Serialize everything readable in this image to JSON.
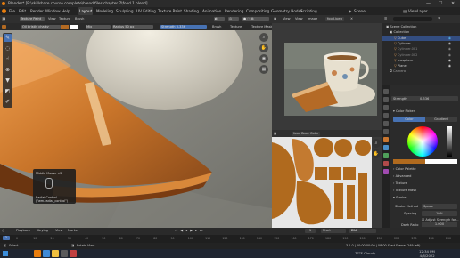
{
  "titlebar": {
    "title": "Blender* [E:\\skillshare course complete\\blend files chapter 7\\food 1.blend]",
    "minimize": "—",
    "maximize": "☐",
    "close": "✕"
  },
  "menu": [
    "File",
    "Edit",
    "Render",
    "Window",
    "Help"
  ],
  "workspaces": [
    "Layout",
    "Modeling",
    "Sculpting",
    "UV Editing",
    "Texture Paint",
    "Shading",
    "Animation",
    "Rendering",
    "Compositing",
    "Geometry Nodes",
    "Scripting"
  ],
  "active_workspace": "Layout",
  "scene": {
    "label": "Scene",
    "view_layer": "ViewLayer"
  },
  "tool_header": {
    "mode": "Texture Paint",
    "menus": [
      "View",
      "Texture",
      "Brush"
    ],
    "brush": "Oil bristly chalky",
    "blend": "Mix",
    "radius_label": "Radius",
    "radius": "50 px",
    "strength_label": "Strength",
    "strength": "0.336",
    "brush_menu": "Brush",
    "texture_menu": "Texture",
    "texture_mask": "Texture Mask"
  },
  "tools": [
    "brush-icon",
    "blur-icon",
    "smear-icon",
    "clone-icon",
    "fill-icon",
    "mask-icon",
    "annotate-icon"
  ],
  "nav_gizmo": [
    "zoom-icon",
    "hand-icon",
    "camera-icon",
    "grid-icon"
  ],
  "hud": {
    "line1": "Middle Mouse ×2",
    "line2": "Radial Control (“wm.radial_control”)"
  },
  "image_editor": {
    "menus": [
      "View",
      "View",
      "Image"
    ],
    "filename": "food.jpeg"
  },
  "uv_editor": {
    "header": "food Base Color"
  },
  "outliner": {
    "rows": [
      {
        "name": "Scene Collection",
        "indent": 0
      },
      {
        "name": "Collection",
        "indent": 1
      },
      {
        "name": "Cube",
        "indent": 2,
        "selected": true
      },
      {
        "name": "Cylinder",
        "indent": 2
      },
      {
        "name": "Cylinder.001",
        "indent": 2
      },
      {
        "name": "Cylinder.002",
        "indent": 2
      },
      {
        "name": "Icosphere",
        "indent": 2
      },
      {
        "name": "Plane",
        "indent": 2
      },
      {
        "name": "Camera",
        "indent": 1
      }
    ]
  },
  "properties": {
    "strength_label": "Strength",
    "strength": "0.336",
    "color_picker": "Color Picker",
    "tabs": [
      "Color",
      "Gradient"
    ],
    "active_tab": "Color",
    "sections": [
      "Color Palette",
      "Advanced",
      "Texture",
      "Texture Mask",
      "Stroke"
    ],
    "stroke_method_label": "Stroke Method",
    "stroke_method": "Space",
    "spacing_label": "Spacing",
    "spacing": "10%",
    "adjust_strength": "Adjust Strength for...",
    "dash_ratio_label": "Dash Ratio",
    "dash_ratio": "1.000",
    "dash_length_label": "Dash Length",
    "dash_length": "20",
    "wheel_value": "1"
  },
  "timeline": {
    "menus": [
      "Playback",
      "Keying",
      "View",
      "Marker"
    ],
    "ruler": [
      "0",
      "10",
      "20",
      "30",
      "40",
      "50",
      "60",
      "70",
      "80",
      "90",
      "100",
      "110",
      "120",
      "130",
      "140",
      "150",
      "160",
      "170",
      "180",
      "190",
      "200",
      "210",
      "220",
      "230",
      "240",
      "250"
    ],
    "current_frame": "1",
    "start_label": "Start",
    "start": "1",
    "end_label": "End",
    "end": "250"
  },
  "statusbar": {
    "left": "Select",
    "middle": "Rotate View",
    "right": "3.1.0 | 00:00:00:00 | 08:00 Start Frame (249 left)"
  },
  "taskbar": {
    "weather": "77°F  Cloudy",
    "time": "12:34 PM",
    "date": "4/8/2022"
  },
  "colors": {
    "accent": "#4772b3",
    "active_color": "#b06a1e",
    "brush_swatch_fg": "#b36a22",
    "brush_swatch_bg": "#ffffff"
  }
}
